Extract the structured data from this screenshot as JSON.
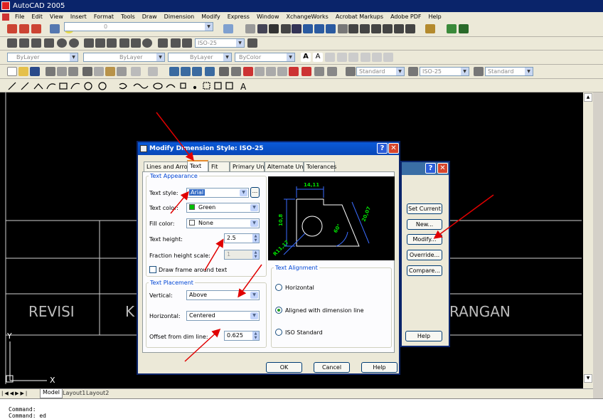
{
  "app": {
    "title": "AutoCAD 2005"
  },
  "menu": [
    "File",
    "Edit",
    "View",
    "Insert",
    "Format",
    "Tools",
    "Draw",
    "Dimension",
    "Modify",
    "Express",
    "Window",
    "XchangeWorks",
    "Acrobat Markups",
    "Adobe PDF",
    "Help"
  ],
  "toolbar": {
    "layer_value": "0",
    "dimstyle_combo": "ISO-25",
    "layer_combo": "ByLayer",
    "linetype_combo": "ByLayer",
    "lineweight_combo": "ByLayer",
    "color_combo": "ByColor",
    "text_style_combo": "Standard",
    "dim_style_combo2": "ISO-25",
    "table_style_combo": "Standard"
  },
  "canvas": {
    "text_revisi": "REVISI",
    "text_k": "K",
    "text_rangan": "RANGAN",
    "ucs_y": "Y",
    "ucs_x": "X"
  },
  "layout_tabs": [
    "Model",
    "Layout1",
    "Layout2"
  ],
  "command_lines": [
    "Command:",
    "Command: ed"
  ],
  "style_manager": {
    "buttons": [
      "Set Current",
      "New...",
      "Modify...",
      "Override...",
      "Compare...",
      "Help"
    ]
  },
  "dialog": {
    "title": "Modify Dimension Style: ISO-25",
    "tabs": [
      "Lines and Arrows",
      "Text",
      "Fit",
      "Primary Units",
      "Alternate Units",
      "Tolerances"
    ],
    "active_tab": "Text",
    "text_appearance": {
      "group_label": "Text Appearance",
      "text_style_label": "Text style:",
      "text_style_value": "Arial",
      "text_color_label": "Text color:",
      "text_color_value": "Green",
      "text_color_hex": "#00c000",
      "fill_color_label": "Fill color:",
      "fill_color_value": "None",
      "text_height_label": "Text height:",
      "text_height_value": "2.5",
      "fraction_label": "Fraction height scale:",
      "fraction_value": "1",
      "frame_label": "Draw frame around text"
    },
    "text_placement": {
      "group_label": "Text Placement",
      "vertical_label": "Vertical:",
      "vertical_value": "Above",
      "horizontal_label": "Horizontal:",
      "horizontal_value": "Centered",
      "offset_label": "Offset from dim line:",
      "offset_value": "0.625"
    },
    "text_alignment": {
      "group_label": "Text Alignment",
      "options": [
        "Horizontal",
        "Aligned with dimension line",
        "ISO Standard"
      ],
      "selected": "Aligned with dimension line"
    },
    "preview": {
      "dim_top": "14,11",
      "dim_left": "10,8",
      "dim_right": "20,07",
      "dim_angle": "60°",
      "dim_radius": "R11,17"
    },
    "buttons": {
      "ok": "OK",
      "cancel": "Cancel",
      "help": "Help"
    },
    "ellipsis": "..."
  }
}
